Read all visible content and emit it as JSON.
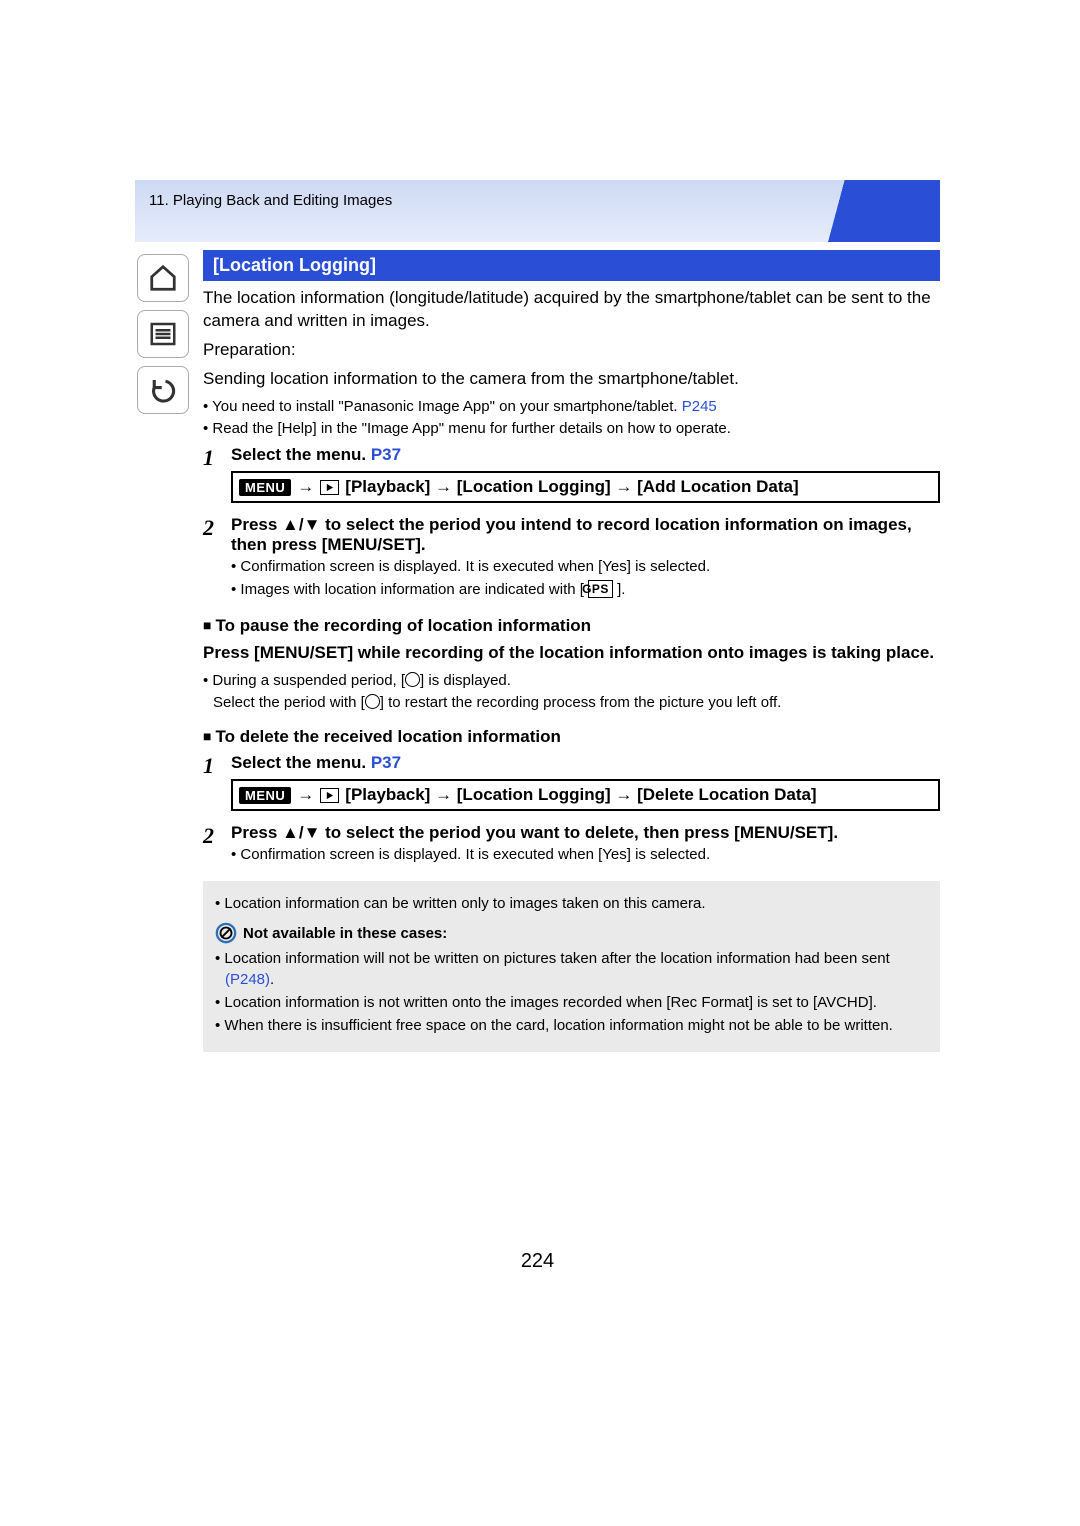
{
  "chapter": "11. Playing Back and Editing Images",
  "section_title": "[Location Logging]",
  "intro": "The location information (longitude/latitude) acquired by the smartphone/tablet can be sent to the camera and written in images.",
  "prep_label": "Preparation:",
  "prep_line": "Sending location information to the camera from the smartphone/tablet.",
  "prep_bullets": [
    {
      "pre": "• You need to install \"Panasonic Image App\" on your smartphone/tablet. ",
      "link": "P245"
    },
    {
      "pre": "• Read the [Help] in the \"Image App\" menu for further details on how to operate.",
      "link": ""
    }
  ],
  "step1": {
    "num": "1",
    "text": "Select the menu. ",
    "link": "P37"
  },
  "menu_label": "MENU",
  "menu_path1": "[Playback] → [Location Logging] → [Add Location Data]",
  "step2": {
    "num": "2",
    "text": "Press ▲/▼ to select the period you intend to record location information on images, then press [MENU/SET].",
    "sub1": "• Confirmation screen is displayed. It is executed when [Yes] is selected.",
    "sub2_pre": "• Images with location information are indicated with [ ",
    "gps": "GPS",
    "sub2_post": " ]."
  },
  "pause_head": "To pause the recording of location information",
  "pause_body": "Press [MENU/SET] while recording of the location information onto images is taking place.",
  "pause_b1_pre": "• During a suspended period, [",
  "pause_b1_post": "] is displayed.",
  "pause_b2_pre": "Select the period with [",
  "pause_b2_post": "] to restart the recording process from the picture you left off.",
  "delete_head": "To delete the received location information",
  "step1b": {
    "num": "1",
    "text": "Select the menu. ",
    "link": "P37"
  },
  "menu_path2": "[Playback] → [Location Logging] → [Delete Location Data]",
  "step2b": {
    "num": "2",
    "text": "Press ▲/▼ to select the period you want to delete, then press [MENU/SET].",
    "sub1": "• Confirmation screen is displayed. It is executed when [Yes] is selected."
  },
  "note_top": "• Location information can be written only to images taken on this camera.",
  "not_avail_head": "Not available in these cases:",
  "not_avail_items": [
    {
      "pre": "• Location information will not be written on pictures taken after the location information had been sent ",
      "link": "(P248)",
      "post": "."
    },
    {
      "pre": "• Location information is not written onto the images recorded when [Rec Format] is set to [AVCHD].",
      "link": "",
      "post": ""
    },
    {
      "pre": "• When there is insufficient free space on the card, location information might not be able to be written.",
      "link": "",
      "post": ""
    }
  ],
  "page_number": "224"
}
